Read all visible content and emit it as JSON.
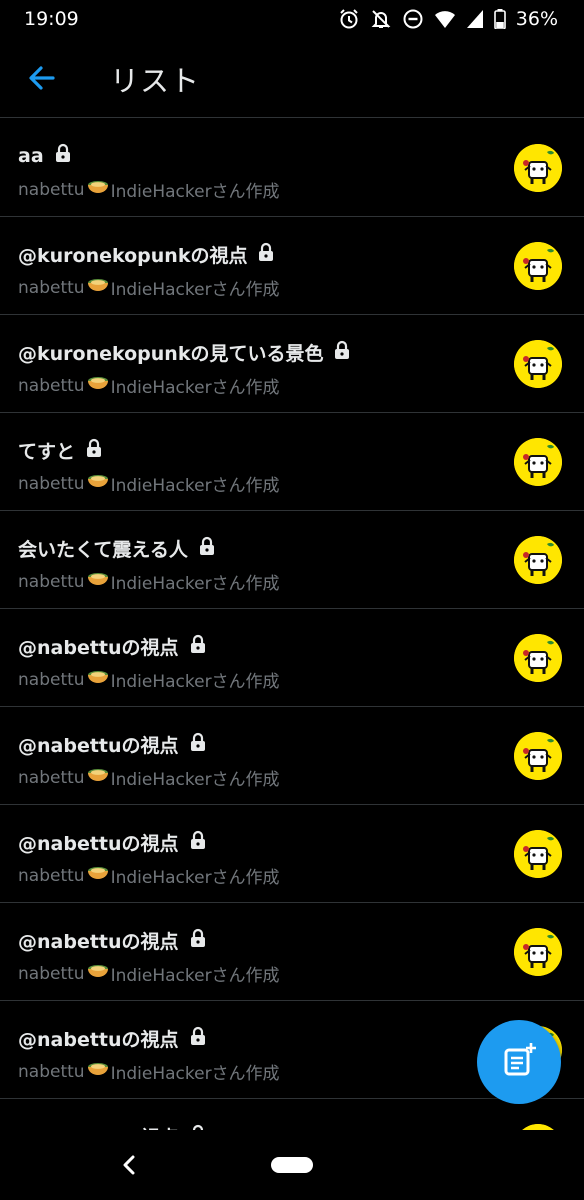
{
  "status_bar": {
    "time": "19:09",
    "battery": "36%",
    "icons": [
      "alarm-icon",
      "notifications-off-icon",
      "do-not-disturb-icon",
      "wifi-icon",
      "signal-icon",
      "battery-icon"
    ]
  },
  "header": {
    "title": "リスト",
    "back_icon": "arrow-left-icon"
  },
  "lists": [
    {
      "name": "aa",
      "creator": "nabettu",
      "creator_suffix": "IndieHackerさん作成",
      "private": true
    },
    {
      "name": "@kuronekopunkの視点",
      "creator": "nabettu",
      "creator_suffix": "IndieHackerさん作成",
      "private": true
    },
    {
      "name": "@kuronekopunkの見ている景色",
      "creator": "nabettu",
      "creator_suffix": "IndieHackerさん作成",
      "private": true
    },
    {
      "name": "てすと",
      "creator": "nabettu",
      "creator_suffix": "IndieHackerさん作成",
      "private": true
    },
    {
      "name": "会いたくて震える人",
      "creator": "nabettu",
      "creator_suffix": "IndieHackerさん作成",
      "private": true
    },
    {
      "name": "@nabettuの視点",
      "creator": "nabettu",
      "creator_suffix": "IndieHackerさん作成",
      "private": true
    },
    {
      "name": "@nabettuの視点",
      "creator": "nabettu",
      "creator_suffix": "IndieHackerさん作成",
      "private": true
    },
    {
      "name": "@nabettuの視点",
      "creator": "nabettu",
      "creator_suffix": "IndieHackerさん作成",
      "private": true
    },
    {
      "name": "@nabettuの視点",
      "creator": "nabettu",
      "creator_suffix": "IndieHackerさん作成",
      "private": true
    },
    {
      "name": "@nabettuの視点",
      "creator": "nabettu",
      "creator_suffix": "IndieHackerさん作成",
      "private": true
    },
    {
      "name": "@nabettuの視点",
      "creator": "",
      "creator_suffix": "",
      "private": true
    }
  ],
  "fab": {
    "icon": "new-list-icon"
  },
  "colors": {
    "background": "#000000",
    "accent": "#1d9bf0",
    "divider": "#2f3336",
    "secondary_text": "#71767b",
    "avatar_bg": "#ffe600"
  }
}
